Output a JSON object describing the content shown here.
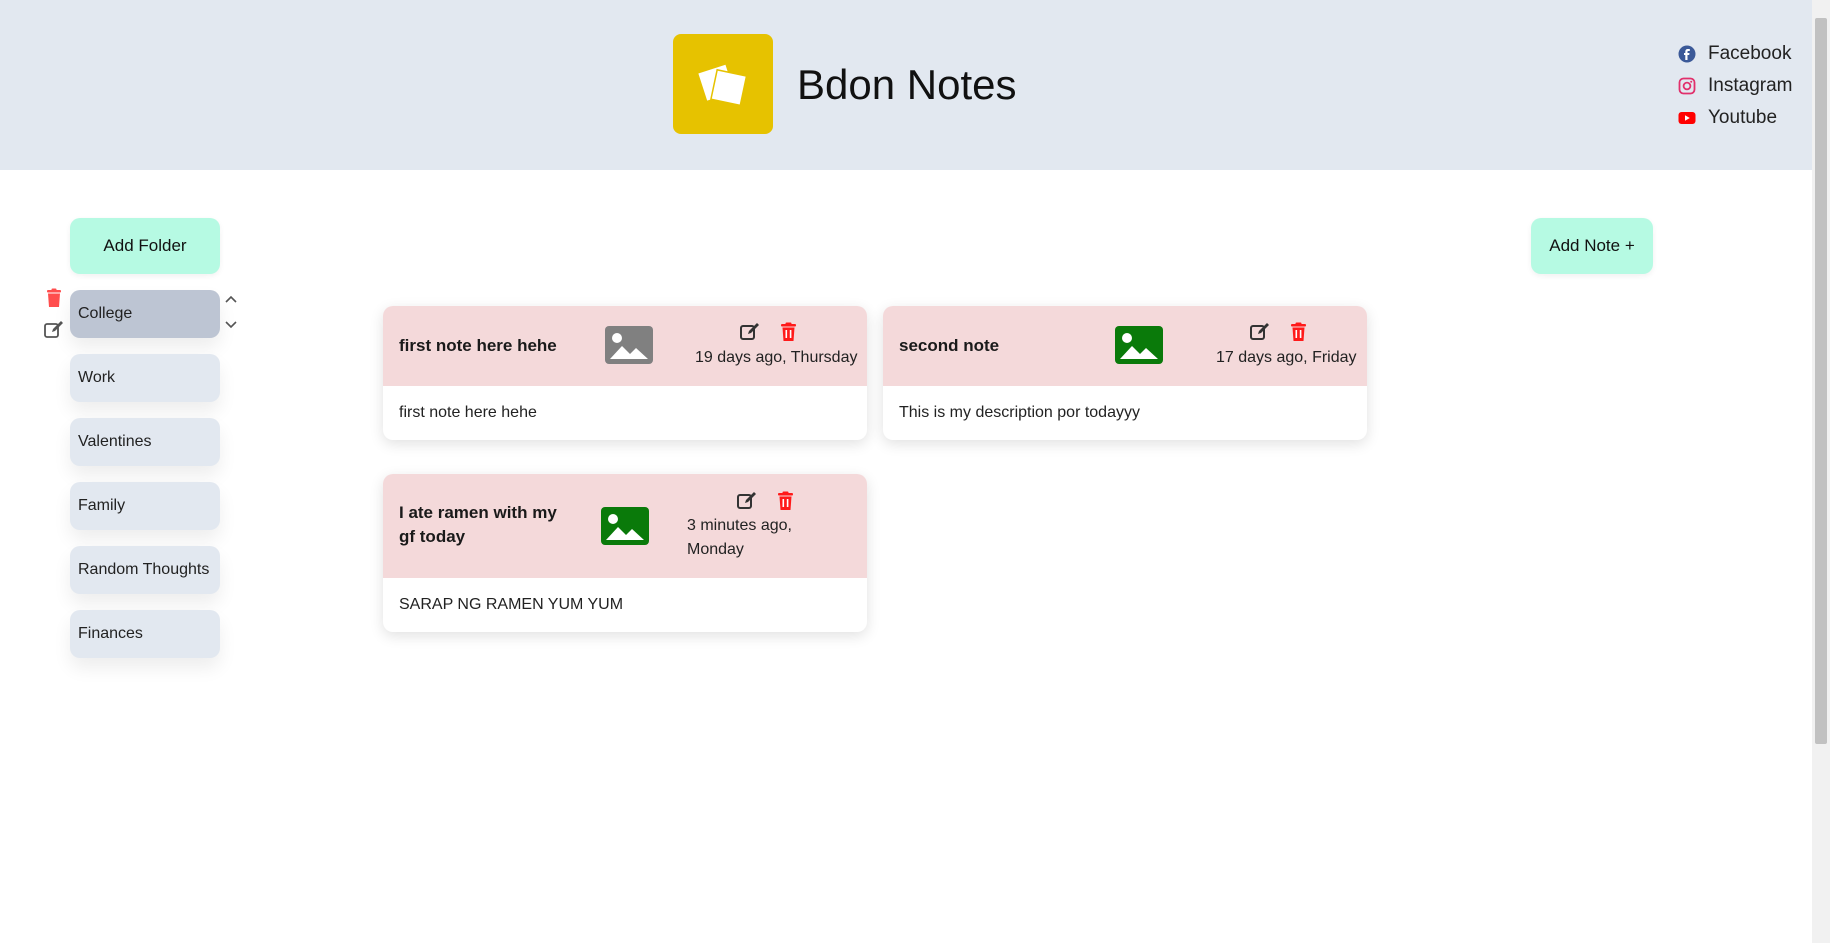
{
  "header": {
    "title": "Bdon Notes",
    "logo_color": "#e6c200",
    "social": [
      {
        "label": "Facebook",
        "icon": "facebook-icon",
        "color": "#3b5998"
      },
      {
        "label": "Instagram",
        "icon": "instagram-icon",
        "color": "#e1306c"
      },
      {
        "label": "Youtube",
        "icon": "youtube-icon",
        "color": "#ff0000"
      }
    ]
  },
  "toolbar": {
    "add_folder_label": "Add Folder",
    "add_note_label": "Add Note +"
  },
  "folders": [
    {
      "label": "College",
      "active": true
    },
    {
      "label": "Work"
    },
    {
      "label": "Valentines"
    },
    {
      "label": "Family"
    },
    {
      "label": "Random Thoughts"
    },
    {
      "label": "Finances"
    }
  ],
  "notes": [
    {
      "title": "first note here hehe",
      "date": "19 days ago, Thursday",
      "body": "first note here hehe",
      "image_color": "#808080"
    },
    {
      "title": "second note",
      "date": "17 days ago, Friday",
      "body": "This is my description por todayyy",
      "image_color": "#0a7a0a"
    },
    {
      "title": "I ate ramen with my gf today",
      "date": "3 minutes ago, Monday",
      "body": "SARAP NG RAMEN YUM YUM",
      "image_color": "#0a7a0a"
    }
  ],
  "colors": {
    "header_bg": "#e2e8f0",
    "button_green": "#b6fae3",
    "card_head": "#f4d9da",
    "delete_red": "#ff1a1a"
  }
}
